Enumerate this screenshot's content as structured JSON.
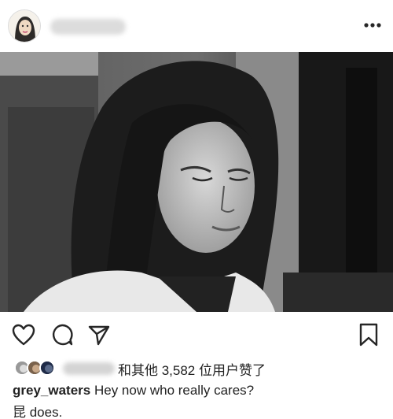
{
  "post": {
    "header": {
      "avatar_icon": "woman-portrait-icon",
      "more_icon": "more-dots-icon"
    },
    "photo": {
      "alt": "black-and-white photo of crying woman"
    },
    "actions": {
      "like_icon": "heart-icon",
      "comment_icon": "comment-bubble-icon",
      "share_icon": "paper-plane-icon",
      "save_icon": "bookmark-icon"
    },
    "likes": {
      "text": "和其他 3,582 位用户赞了"
    },
    "caption": {
      "username": "grey_waters",
      "text": "Hey now who really cares?",
      "line2": "昆 does."
    }
  }
}
